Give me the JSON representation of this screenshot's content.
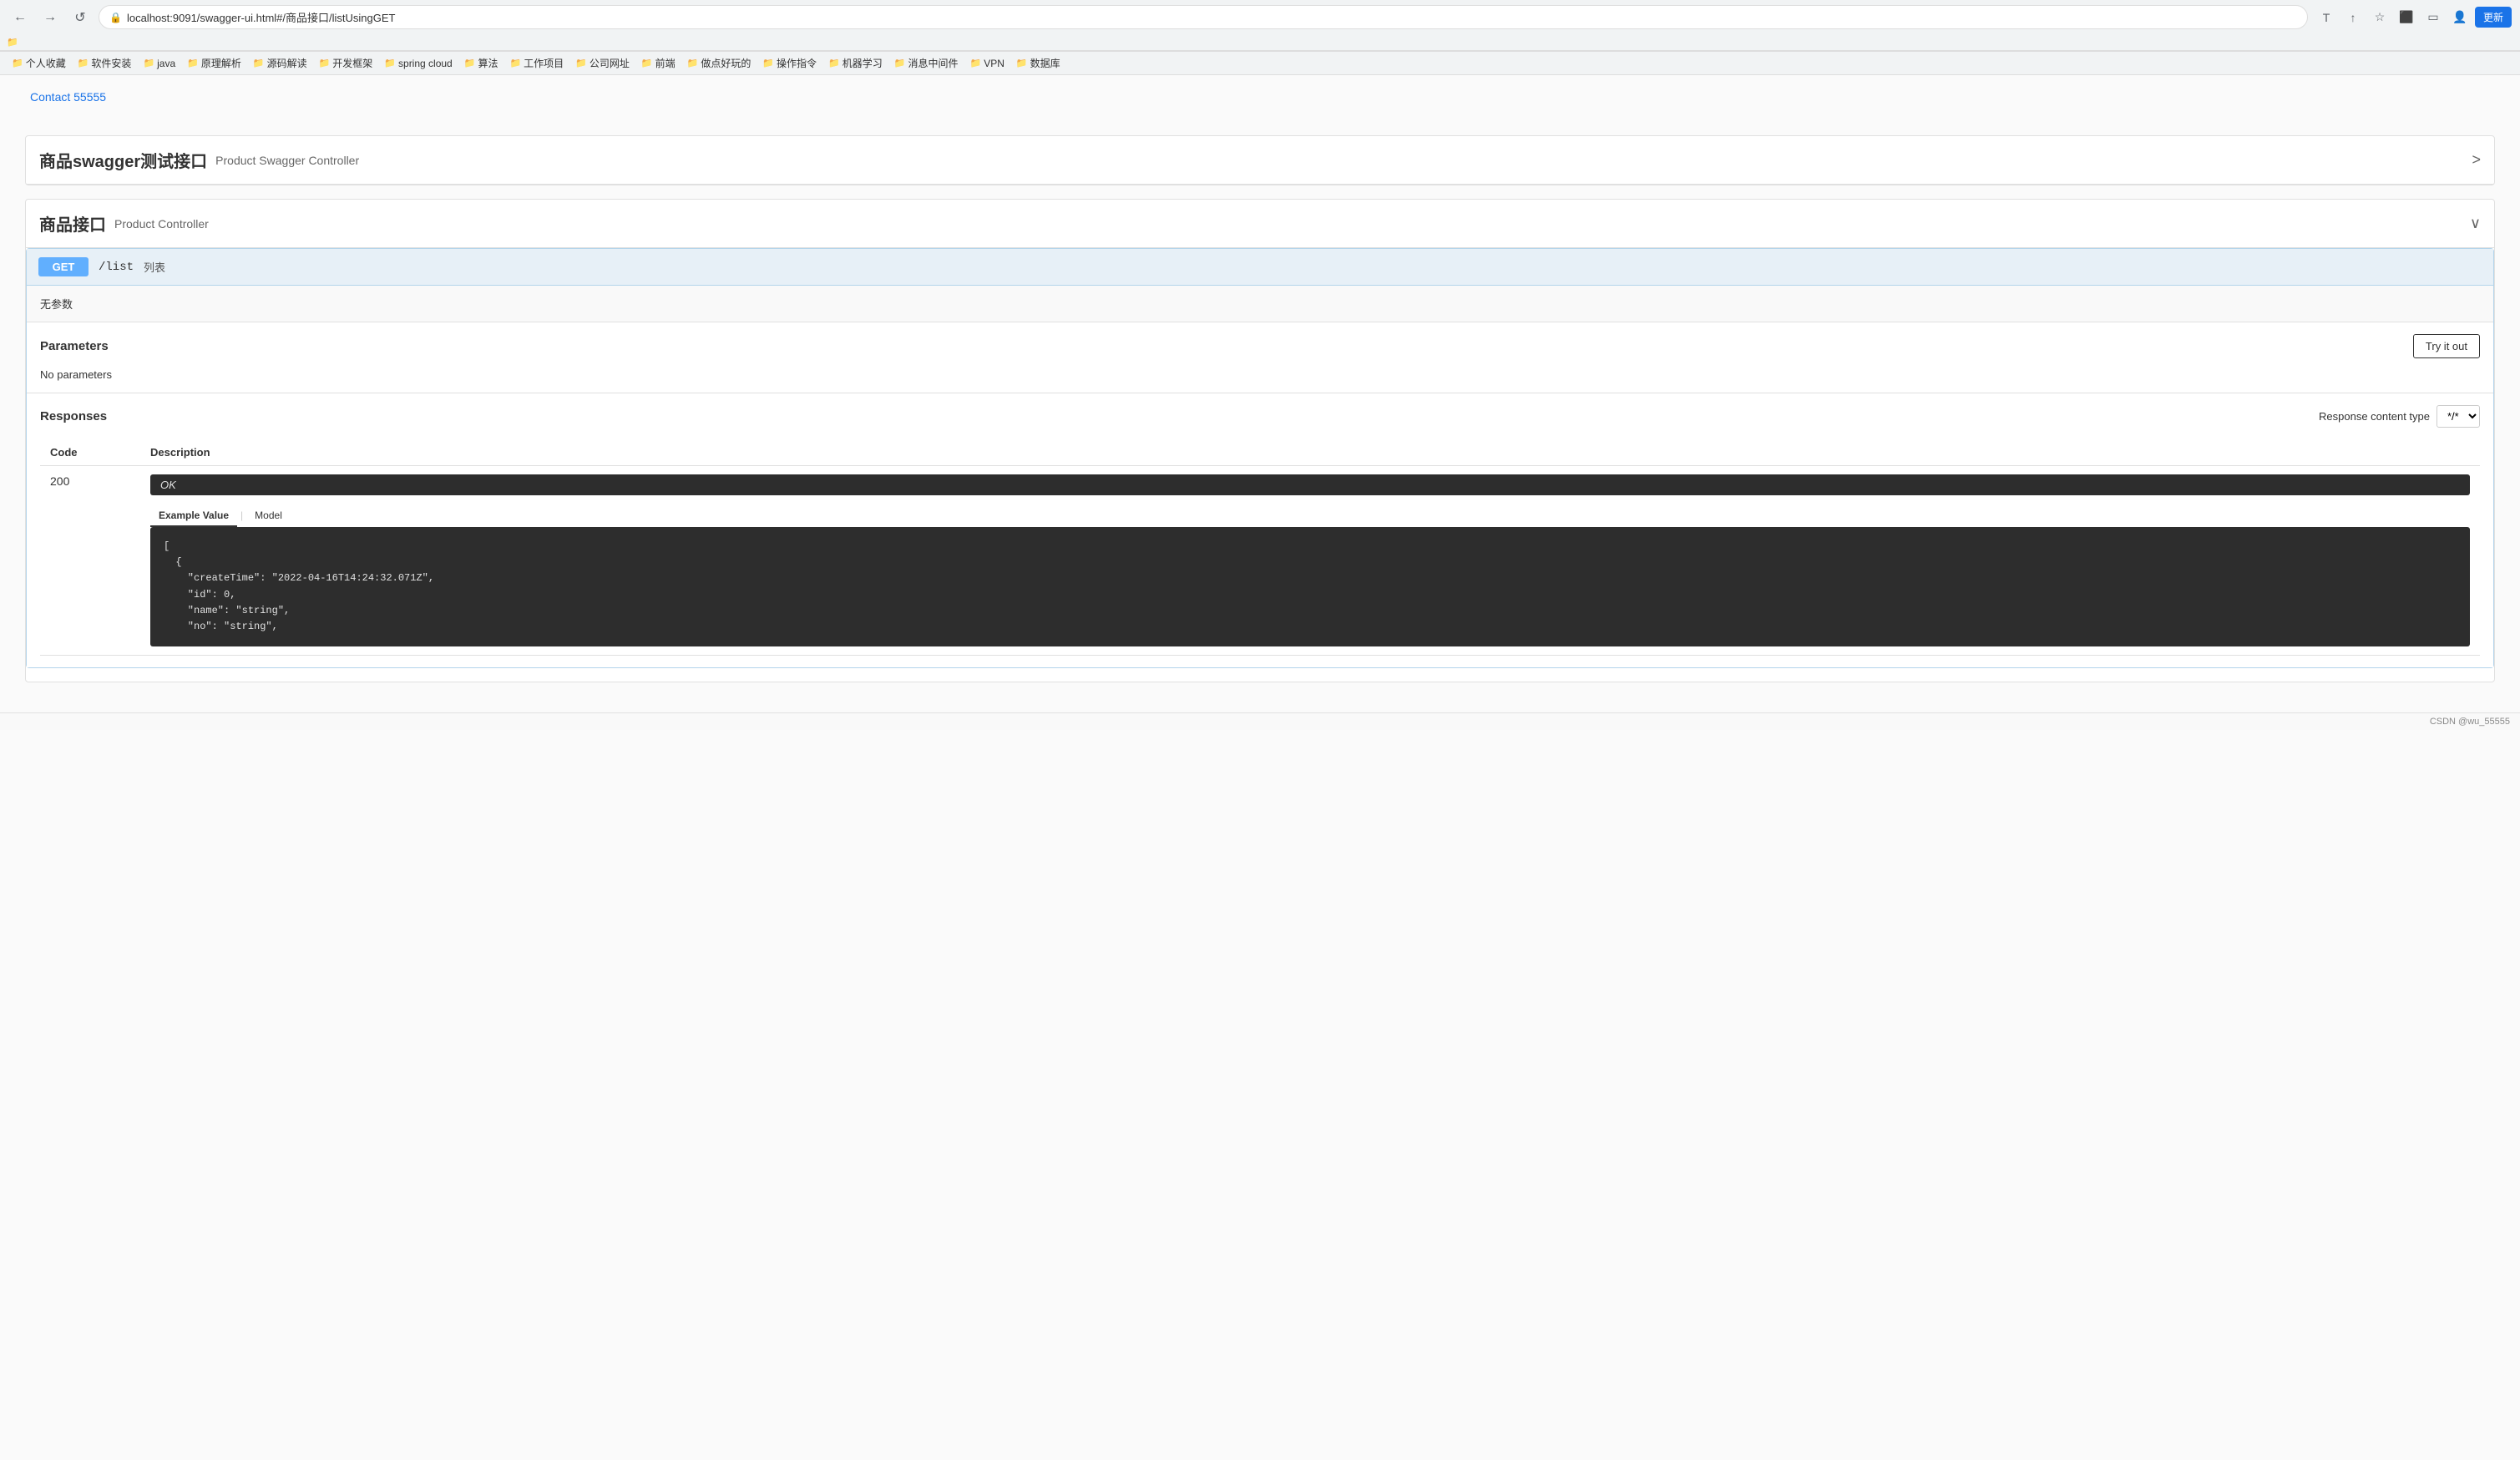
{
  "browser": {
    "url": "localhost:9091/swagger-ui.html#/商品接口/listUsingGET",
    "back_btn": "←",
    "forward_btn": "→",
    "reload_btn": "↺",
    "translate_icon": "T",
    "share_icon": "↑",
    "star_icon": "☆",
    "extensions_icon": "⬛",
    "sidebar_icon": "☰",
    "profile_icon": "👤",
    "update_label": "更新"
  },
  "bookmarks": [
    {
      "label": "个人收藏"
    },
    {
      "label": "软件安装"
    },
    {
      "label": "java"
    },
    {
      "label": "原理解析"
    },
    {
      "label": "源码解读"
    },
    {
      "label": "开发框架"
    },
    {
      "label": "spring cloud"
    },
    {
      "label": "算法"
    },
    {
      "label": "工作项目"
    },
    {
      "label": "公司网址"
    },
    {
      "label": "前端"
    },
    {
      "label": "做点好玩的"
    },
    {
      "label": "操作指令"
    },
    {
      "label": "机器学习"
    },
    {
      "label": "消息中间件"
    },
    {
      "label": "VPN"
    },
    {
      "label": "数据库"
    }
  ],
  "contact_link": "Contact 55555",
  "swagger_section1": {
    "title": "商品swagger测试接口",
    "subtitle": "Product Swagger Controller",
    "chevron": ">"
  },
  "swagger_section2": {
    "title": "商品接口",
    "subtitle": "Product Controller",
    "chevron": "∨"
  },
  "api": {
    "method": "GET",
    "path": "/list",
    "description": "列表",
    "no_params_label": "无参数",
    "parameters_title": "Parameters",
    "try_it_out_label": "Try it out",
    "no_parameters_text": "No parameters",
    "responses_title": "Responses",
    "response_content_type_label": "Response content type",
    "content_type_value": "*/*",
    "code_col": "Code",
    "desc_col": "Description",
    "response_code": "200",
    "ok_label": "OK",
    "example_value_tab": "Example Value",
    "model_tab": "Model",
    "code_block": "[\n  {\n    \"createTime\": \"2022-04-16T14:24:32.071Z\",\n    \"id\": 0,\n    \"name\": \"string\",\n    \"no\": \"string\","
  },
  "footer": {
    "text": "CSDN @wu_55555"
  }
}
